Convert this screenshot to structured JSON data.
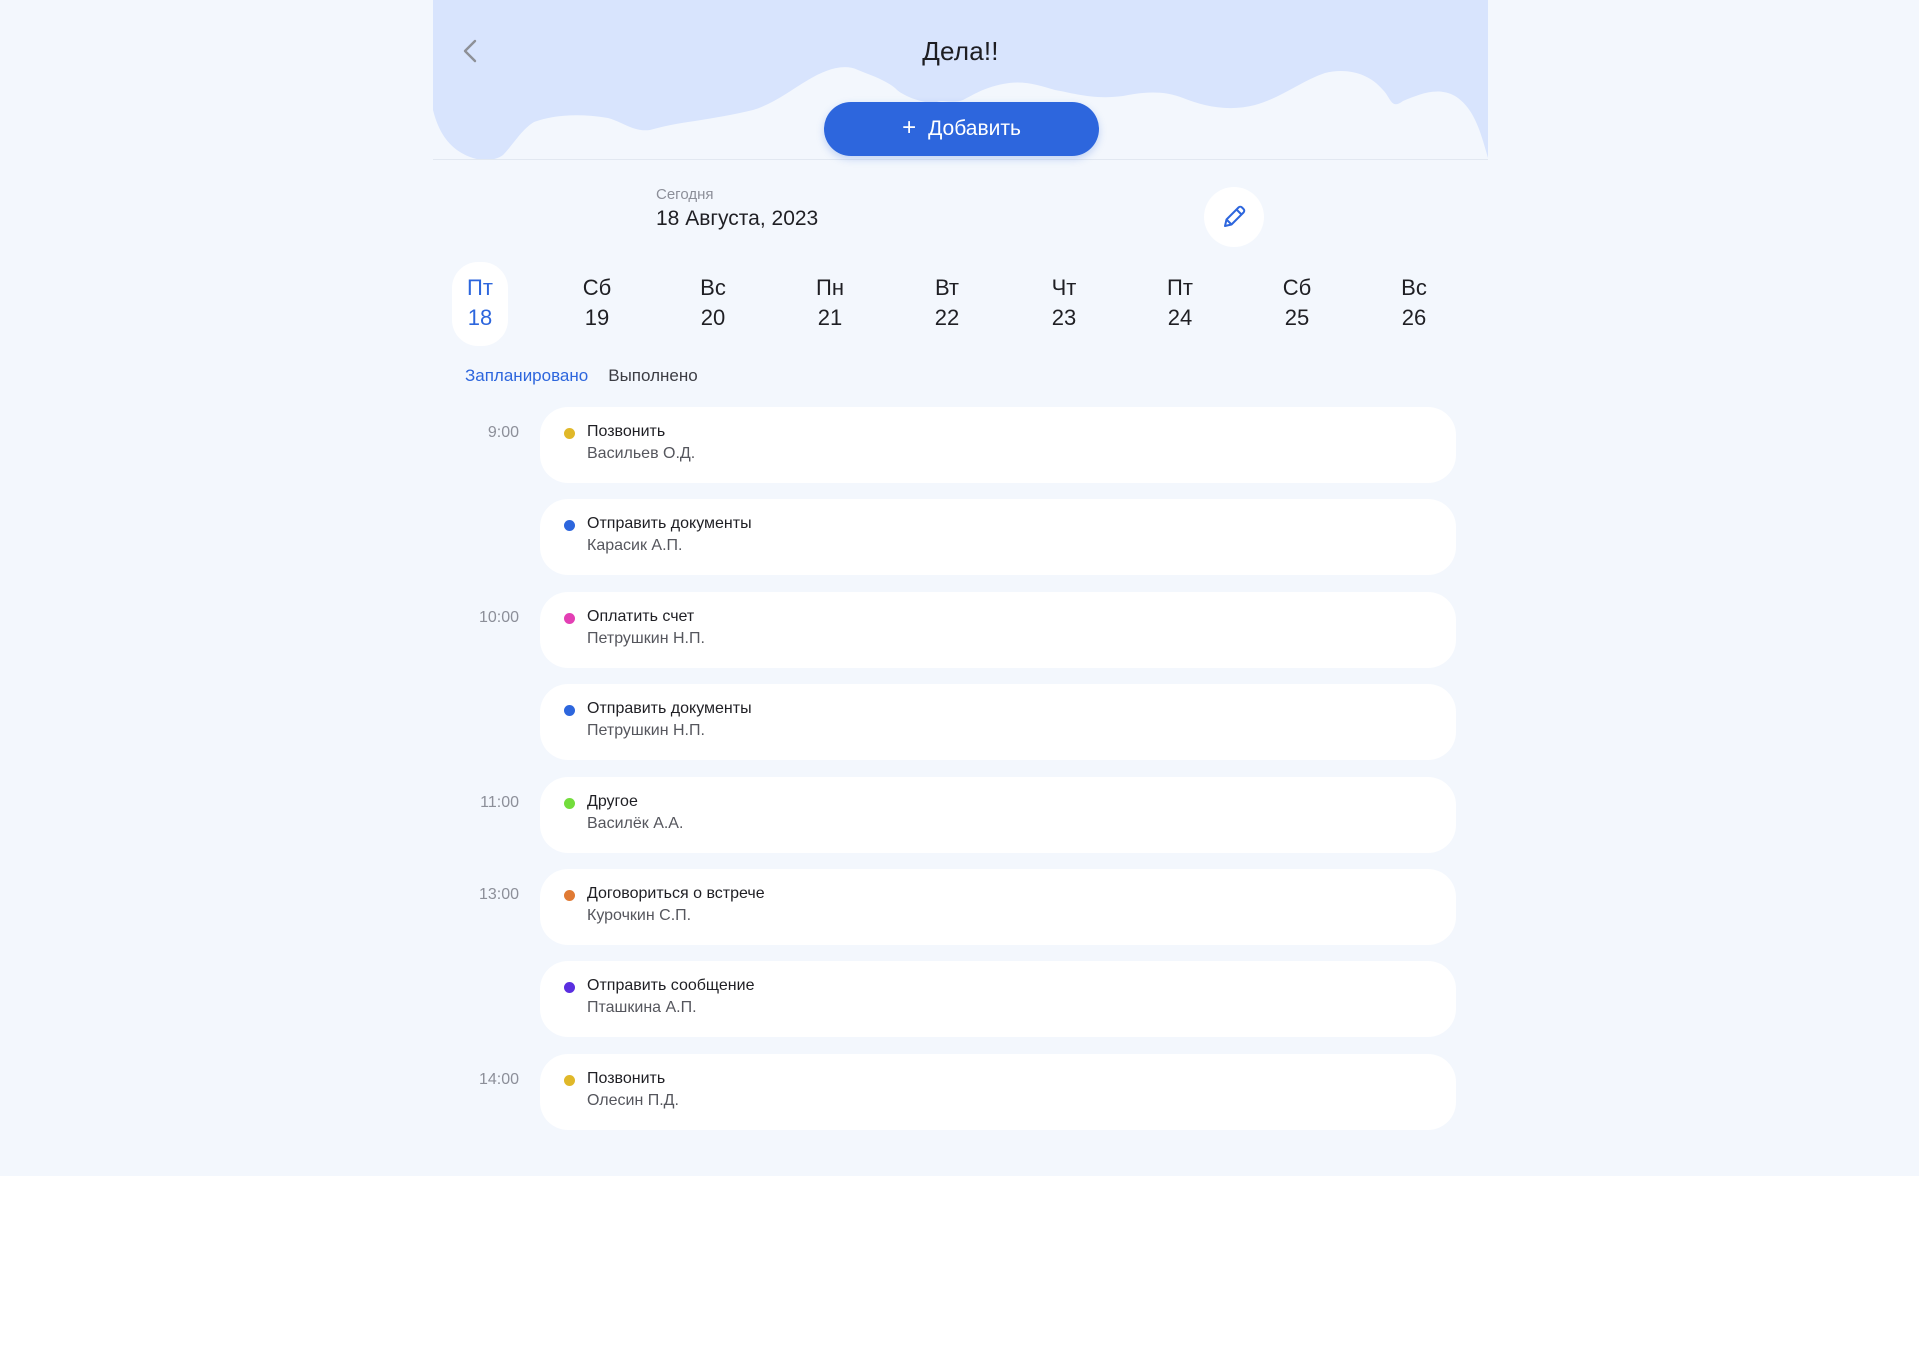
{
  "header": {
    "title": "Дела!!",
    "add_label": "Добавить",
    "add_icon": "plus",
    "back_icon": "chevron-left"
  },
  "today": {
    "label": "Сегодня",
    "date": "18 Августа, 2023",
    "edit_icon": "pencil"
  },
  "days": [
    {
      "name": "Пт",
      "num": "18",
      "active": true
    },
    {
      "name": "Сб",
      "num": "19",
      "active": false
    },
    {
      "name": "Вс",
      "num": "20",
      "active": false
    },
    {
      "name": "Пн",
      "num": "21",
      "active": false
    },
    {
      "name": "Вт",
      "num": "22",
      "active": false
    },
    {
      "name": "Чт",
      "num": "23",
      "active": false
    },
    {
      "name": "Пт",
      "num": "24",
      "active": false
    },
    {
      "name": "Сб",
      "num": "25",
      "active": false
    },
    {
      "name": "Вс",
      "num": "26",
      "active": false
    }
  ],
  "tabs": [
    {
      "label": "Запланировано",
      "active": true
    },
    {
      "label": "Выполнено",
      "active": false
    }
  ],
  "tasks": [
    {
      "time": "9:00",
      "title": "Позвонить",
      "person": "Васильев О.Д.",
      "color": "#e0b829"
    },
    {
      "time": "",
      "title": "Отправить документы",
      "person": "Карасик А.П.",
      "color": "#2d66dd"
    },
    {
      "time": "10:00",
      "title": "Оплатить счет",
      "person": "Петрушкин Н.П.",
      "color": "#e33fb4"
    },
    {
      "time": "",
      "title": "Отправить документы",
      "person": "Петрушкин Н.П.",
      "color": "#2d66dd"
    },
    {
      "time": "11:00",
      "title": "Другое",
      "person": "Василёк А.А.",
      "color": "#73dd3c"
    },
    {
      "time": "13:00",
      "title": "Договориться о встрече",
      "person": "Курочкин С.П.",
      "color": "#e07a34"
    },
    {
      "time": "",
      "title": "Отправить сообщение",
      "person": "Пташкина А.П.",
      "color": "#5a2ee0"
    },
    {
      "time": "14:00",
      "title": "Позвонить",
      "person": "Олесин П.Д.",
      "color": "#e0b829"
    }
  ],
  "colors": {
    "accent": "#2d66dd",
    "header_wave": "#d8e4fd",
    "page_background": "#f3f7fd"
  }
}
